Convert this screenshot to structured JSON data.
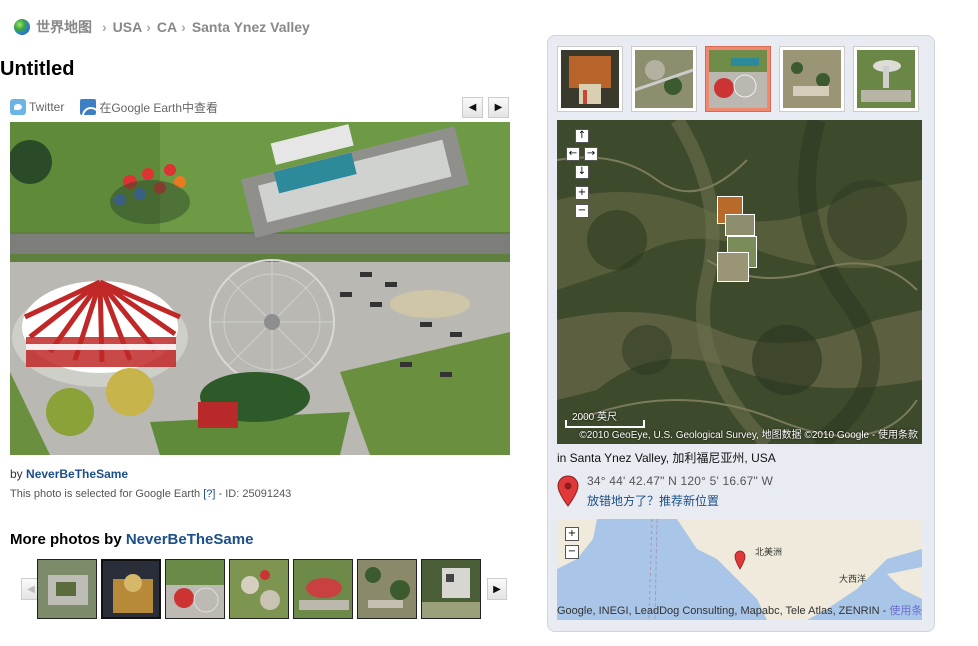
{
  "breadcrumb": {
    "site": "世界地图",
    "items": [
      "USA",
      "CA",
      "Santa Ynez Valley"
    ]
  },
  "photo": {
    "title": "Untitled",
    "author_prefix": "by",
    "author": "NeverBeTheSame",
    "note_prefix": "This photo is selected for Google Earth",
    "note_help": "[?]",
    "note_id": "- ID: 25091243"
  },
  "share": {
    "twitter": "Twitter",
    "google_earth": "在Google Earth中查看"
  },
  "more": {
    "title_prefix": "More photos by",
    "author": "NeverBeTheSame"
  },
  "map": {
    "scale_label": "2000 英尺",
    "attribution": "©2010 GeoEye, U.S. Geological Survey, 地图数据 ©2010 Google - 使用条款",
    "location": "in Santa Ynez Valley, 加利福尼亚州, USA",
    "coords": "34° 44' 42.47\" N  120° 5' 16.67\" W",
    "wrong_place": "放错地方了？推荐新位置"
  },
  "overview_map": {
    "label_na": "北美洲",
    "label_ocean": "大西洋",
    "attribution": "Google, INEGI, LeadDog Consulting, Mapabc, Tele Atlas, ZENRIN - ",
    "terms": "使用条款"
  },
  "icons": {
    "globe": "globe-icon",
    "twitter": "twitter-icon",
    "google_earth": "google-earth-icon",
    "prev": "chevron-left-icon",
    "next": "chevron-right-icon",
    "pin": "map-pin-icon"
  },
  "colors": {
    "link": "#1a4f8a",
    "panel": "#e8ebf2",
    "active_thumb": "#f08870",
    "pin": "#e0393a"
  }
}
